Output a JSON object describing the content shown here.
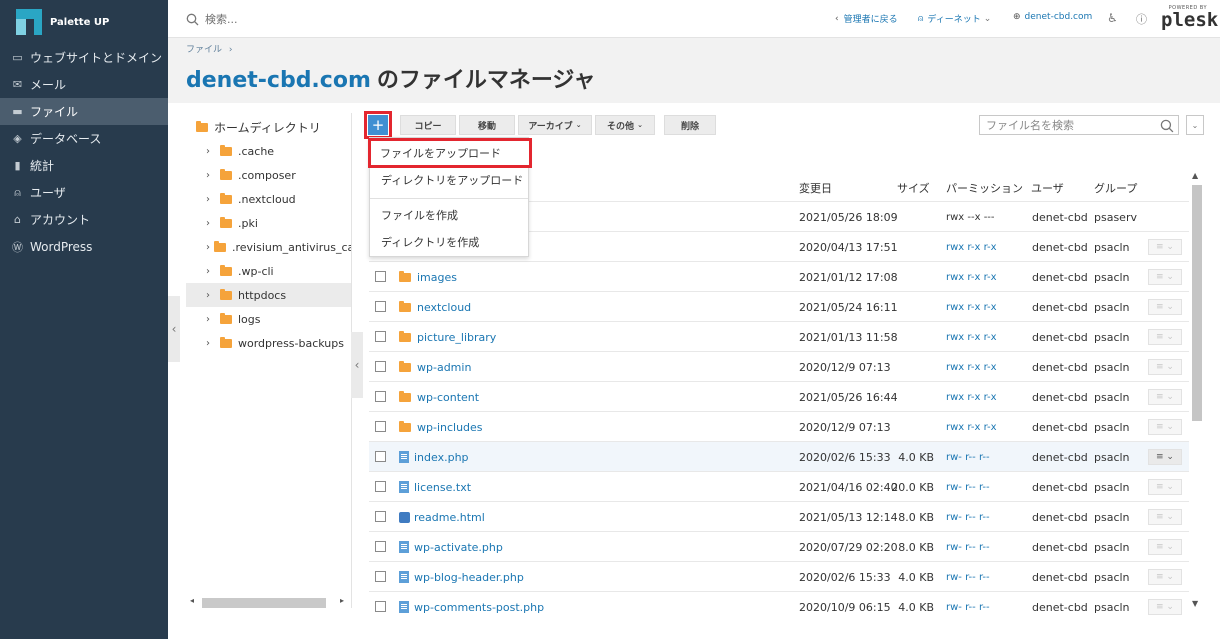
{
  "app": {
    "brand": "Palette UP"
  },
  "sidebar": {
    "items": [
      {
        "label": "ウェブサイトとドメイン",
        "icon": "monitor-icon"
      },
      {
        "label": "メール",
        "icon": "mail-icon"
      },
      {
        "label": "ファイル",
        "icon": "folder-icon",
        "active": true
      },
      {
        "label": "データベース",
        "icon": "database-icon"
      },
      {
        "label": "統計",
        "icon": "stats-icon"
      },
      {
        "label": "ユーザ",
        "icon": "user-icon"
      },
      {
        "label": "アカウント",
        "icon": "account-icon"
      },
      {
        "label": "WordPress",
        "icon": "wordpress-icon"
      }
    ]
  },
  "topbar": {
    "search_placeholder": "検索...",
    "back_admin": "管理者に戻る",
    "user": "ディーネット",
    "domain": "denet-cbd.com",
    "powered_by": "POWERED BY",
    "plesk": "plesk"
  },
  "header": {
    "breadcrumb": "ファイル",
    "title_domain": "denet-cbd.com",
    "title_suffix": "のファイルマネージャ"
  },
  "tree": {
    "root": "ホームディレクトリ",
    "items": [
      ".cache",
      ".composer",
      ".nextcloud",
      ".pki",
      ".revisium_antivirus_cache",
      ".wp-cli",
      "httpdocs",
      "logs",
      "wordpress-backups"
    ],
    "selected": "httpdocs"
  },
  "toolbar": {
    "copy": "コピー",
    "move": "移動",
    "archive": "アーカイブ",
    "more": "その他",
    "delete": "削除",
    "file_search_placeholder": "ファイル名を検索"
  },
  "add_menu": {
    "items": [
      "ファイルをアップロード",
      "ディレクトリをアップロード",
      "ファイルを作成",
      "ディレクトリを作成"
    ]
  },
  "table": {
    "headers": {
      "modified": "変更日",
      "size": "サイズ",
      "permission": "パーミッション",
      "user": "ユーザ",
      "group": "グループ"
    },
    "rows": [
      {
        "name": "",
        "type": "folder",
        "modified": "2021/05/26 18:09",
        "size": "",
        "perm": "rwx --x ---",
        "user": "denet-cbd",
        "group": "psaserv"
      },
      {
        "name": "",
        "type": "folder",
        "modified": "2020/04/13 17:51",
        "size": "",
        "perm": "rwx r-x r-x",
        "user": "denet-cbd",
        "group": "psacln"
      },
      {
        "name": "images",
        "type": "folder",
        "modified": "2021/01/12 17:08",
        "size": "",
        "perm": "rwx r-x r-x",
        "user": "denet-cbd",
        "group": "psacln"
      },
      {
        "name": "nextcloud",
        "type": "folder",
        "modified": "2021/05/24 16:11",
        "size": "",
        "perm": "rwx r-x r-x",
        "user": "denet-cbd",
        "group": "psacln"
      },
      {
        "name": "picture_library",
        "type": "folder",
        "modified": "2021/01/13 11:58",
        "size": "",
        "perm": "rwx r-x r-x",
        "user": "denet-cbd",
        "group": "psacln"
      },
      {
        "name": "wp-admin",
        "type": "folder",
        "modified": "2020/12/9 07:13",
        "size": "",
        "perm": "rwx r-x r-x",
        "user": "denet-cbd",
        "group": "psacln"
      },
      {
        "name": "wp-content",
        "type": "folder",
        "modified": "2021/05/26 16:44",
        "size": "",
        "perm": "rwx r-x r-x",
        "user": "denet-cbd",
        "group": "psacln"
      },
      {
        "name": "wp-includes",
        "type": "folder",
        "modified": "2020/12/9 07:13",
        "size": "",
        "perm": "rwx r-x r-x",
        "user": "denet-cbd",
        "group": "psacln"
      },
      {
        "name": "index.php",
        "type": "file",
        "modified": "2020/02/6 15:33",
        "size": "4.0 KB",
        "perm": "rw- r-- r--",
        "user": "denet-cbd",
        "group": "psacln"
      },
      {
        "name": "license.txt",
        "type": "file",
        "modified": "2021/04/16 02:40",
        "size": "20.0 KB",
        "perm": "rw- r-- r--",
        "user": "denet-cbd",
        "group": "psacln"
      },
      {
        "name": "readme.html",
        "type": "html",
        "modified": "2021/05/13 12:14",
        "size": "8.0 KB",
        "perm": "rw- r-- r--",
        "user": "denet-cbd",
        "group": "psacln"
      },
      {
        "name": "wp-activate.php",
        "type": "file",
        "modified": "2020/07/29 02:20",
        "size": "8.0 KB",
        "perm": "rw- r-- r--",
        "user": "denet-cbd",
        "group": "psacln"
      },
      {
        "name": "wp-blog-header.php",
        "type": "file",
        "modified": "2020/02/6 15:33",
        "size": "4.0 KB",
        "perm": "rw- r-- r--",
        "user": "denet-cbd",
        "group": "psacln"
      },
      {
        "name": "wp-comments-post.php",
        "type": "file",
        "modified": "2020/10/9 06:15",
        "size": "4.0 KB",
        "perm": "rw- r-- r--",
        "user": "denet-cbd",
        "group": "psacln"
      }
    ]
  },
  "colors": {
    "sidebar_bg": "#283b4d",
    "link": "#1a76b2",
    "highlight_red": "#e3262f",
    "folder": "#f5a33b",
    "add_button": "#3f8fd2"
  }
}
